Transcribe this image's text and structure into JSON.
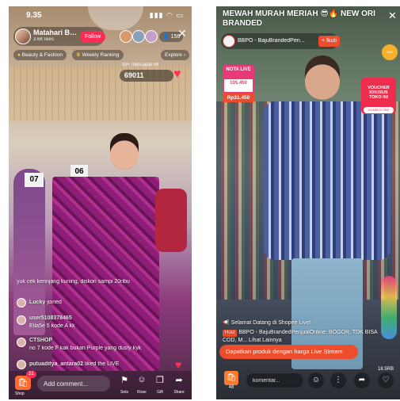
{
  "left": {
    "status_time": "9.35",
    "status_icons": "▮▮▮ ◠ ▭",
    "host_name": "Matahari Bali...",
    "host_likes": "3.6K likes",
    "follow_label": "Follow",
    "viewer_count": "156",
    "close_glyph": "✕",
    "chips": [
      "Beauty & Fashion",
      "Weekly Ranking",
      "Explore"
    ],
    "rank_msg": "99+ mencapai 99",
    "gift_count": "69011",
    "heart_glyph": "♥",
    "chat": [
      {
        "user": "",
        "text": "yuk cek kerinjang kuning, diskon sampi 20ribu"
      },
      {
        "user": "Lucky",
        "text": "joined"
      },
      {
        "user": "user5108378465",
        "text": "Etla5e 5 kode A kk"
      },
      {
        "user": "CTSHOP",
        "text": "no 7 kode F kak bukan Purple yang dusty kyk"
      },
      {
        "user": "putuaditya_antara02",
        "text": "liked the LIVE"
      }
    ],
    "shop_badge": "21",
    "shop_label": "Shop",
    "comment_placeholder": "Add comment...",
    "actions": [
      {
        "icon": "⚑",
        "label": "Sets"
      },
      {
        "icon": "☺",
        "label": "Rose"
      },
      {
        "icon": "❒",
        "label": "Gift"
      },
      {
        "icon": "➦",
        "label": "Share"
      }
    ]
  },
  "right": {
    "title": "MEWAH MURAH MERIAH 😎🔥 NEW ORI BRANDED",
    "close_glyph": "✕",
    "host_name": "BBPO - BajuBrandedPen...",
    "follow_label": "Ikuti",
    "brand_badge": "Mall",
    "nota_head": "NOTA LIVE",
    "nota_value": "105.450",
    "nota_price": "Rp31.450",
    "voucher_text": "VOUCHER\nKHUSUS\nTOKO INI",
    "voucher_button": "KLAIM DI SINI",
    "welcome_msg": "Selamat Datang di Shopee Live!",
    "host_tag": "Host",
    "host_msg": "BBPO - BajuBrandedPenjualOnline: BOGOR, TDK BISA COD, M... Lihat Lainnya",
    "cta": "Dapatkan produk dengan harga Live Stream",
    "shop_count": "48",
    "comment_placeholder": "komentar...",
    "likes": "18.5RB",
    "icons": [
      "☺",
      "⋮",
      "➦",
      "♡"
    ]
  }
}
